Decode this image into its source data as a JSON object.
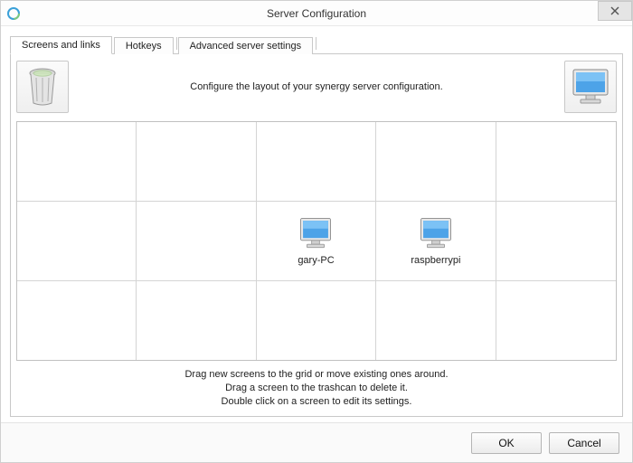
{
  "window": {
    "title": "Server Configuration"
  },
  "tabs": {
    "t0": "Screens and links",
    "t1": "Hotkeys",
    "t2": "Advanced server settings"
  },
  "top": {
    "instruction": "Configure the layout of your synergy server configuration."
  },
  "screens": {
    "cell_1_2": "gary-PC",
    "cell_1_3": "raspberrypi"
  },
  "hints": {
    "line1": "Drag new screens to the grid or move existing ones around.",
    "line2": "Drag a screen to the trashcan to delete it.",
    "line3": "Double click on a screen to edit its settings."
  },
  "buttons": {
    "ok": "OK",
    "cancel": "Cancel"
  }
}
